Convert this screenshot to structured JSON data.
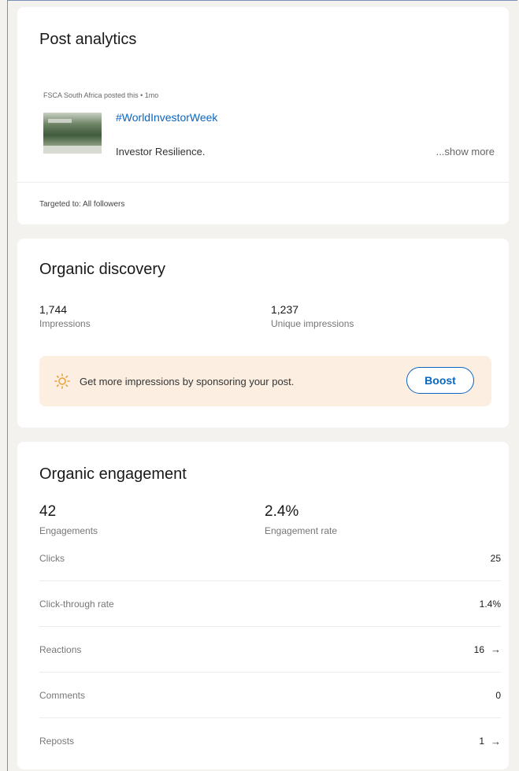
{
  "post_analytics": {
    "title": "Post analytics",
    "meta": "FSCA South Africa posted this • 1mo",
    "hashtag": "#WorldInvestorWeek",
    "text": "Investor Resilience.",
    "show_more": "...show more",
    "targeted": "Targeted to: All followers"
  },
  "discovery": {
    "title": "Organic discovery",
    "impressions_value": "1,744",
    "impressions_label": "Impressions",
    "unique_value": "1,237",
    "unique_label": "Unique impressions",
    "banner_text": "Get more impressions by sponsoring your post.",
    "boost_label": "Boost",
    "banner_icon": "lightbulb-icon"
  },
  "engagement": {
    "title": "Organic engagement",
    "engagements_value": "42",
    "engagements_label": "Engagements",
    "rate_value": "2.4%",
    "rate_label": "Engagement rate",
    "rows": [
      {
        "label": "Clicks",
        "value": "25",
        "arrow": ""
      },
      {
        "label": "Click-through rate",
        "value": "1.4%",
        "arrow": ""
      },
      {
        "label": "Reactions",
        "value": "16",
        "arrow": "→"
      },
      {
        "label": "Comments",
        "value": "0",
        "arrow": ""
      },
      {
        "label": "Reposts",
        "value": "1",
        "arrow": "→"
      }
    ]
  },
  "colors": {
    "link": "#0a66c2",
    "banner_bg": "#fcefe2",
    "bulb": "#e8a33c"
  }
}
